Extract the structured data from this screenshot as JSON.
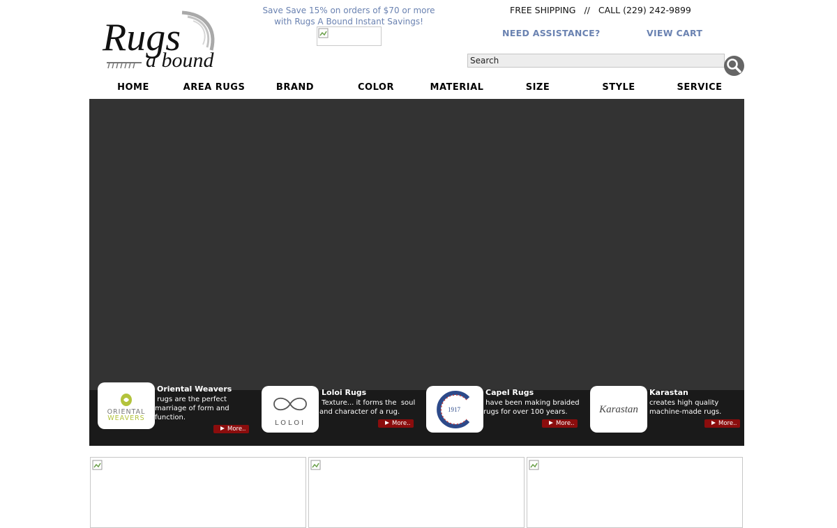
{
  "logo": {
    "line1": "Rugs",
    "line2": "a bound"
  },
  "promo": {
    "line1": "Save Save 15% on orders of $70 or more",
    "line2": "with Rugs A Bound Instant Savings!"
  },
  "header": {
    "free_shipping": "FREE SHIPPING",
    "separator": "//",
    "call": "CALL (229) 242-9899",
    "need_assistance": "NEED ASSISTANCE?",
    "view_cart": "VIEW CART"
  },
  "search": {
    "placeholder": "Search"
  },
  "nav": {
    "home": "HOME",
    "area_rugs": "AREA RUGS",
    "brand": "BRAND",
    "color": "COLOR",
    "material": "MATERIAL",
    "size": "SIZE",
    "style": "STYLE",
    "service": "SERVICE"
  },
  "brands": [
    {
      "name": "Oriental Weavers",
      "desc": " rugs are the perfect\nmarriage of form and\nfunction.",
      "more": "More..",
      "logo_line1": "ORIENTAL",
      "logo_line2": "WEAVERS"
    },
    {
      "name": "Loloi Rugs",
      "desc": " Texture... it forms the  soul\nand character of a rug.",
      "more": "More..",
      "logo_text": "LOLOI"
    },
    {
      "name": "Capel Rugs",
      "desc": " have been making braided\nrugs for over 100 years.",
      "more": "More..",
      "logo_text": "1917"
    },
    {
      "name": "Karastan",
      "desc": "creates high quality\nmachine-made rugs.",
      "more": "More..",
      "logo_text": "Karastan"
    }
  ],
  "colors": {
    "accent_link": "#6a82b1",
    "hero_bg": "#333333",
    "strip_bg": "#1a1a1a",
    "more_btn": "#8b0d0d"
  }
}
